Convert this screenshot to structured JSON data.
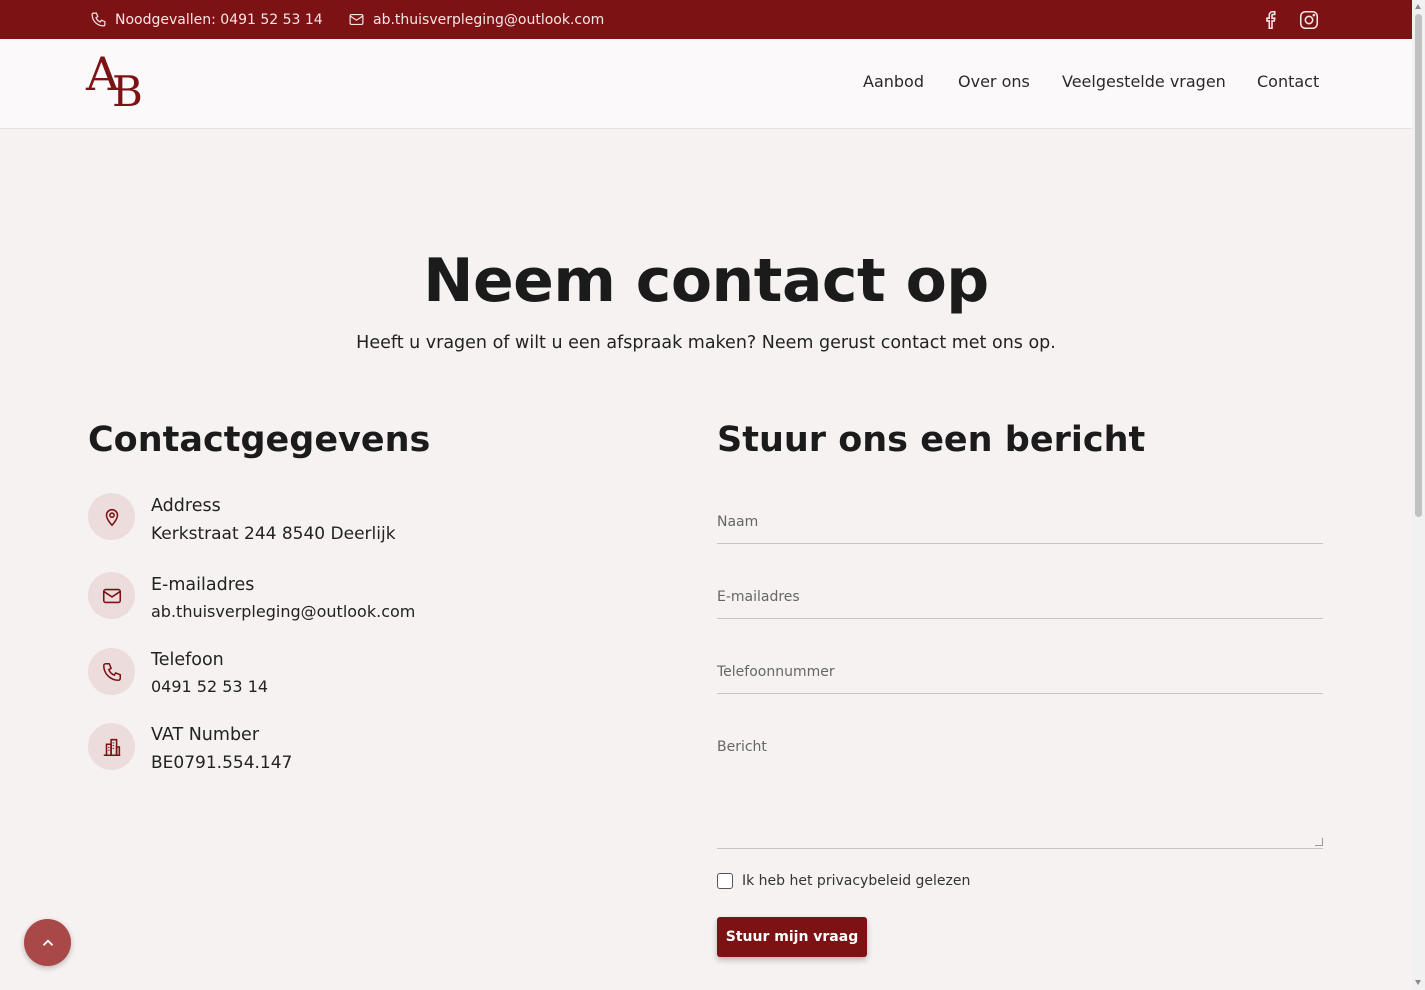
{
  "topbar": {
    "phone_text": "Noodgevallen: 0491 52 53 14",
    "email_text": "ab.thuisverpleging@outlook.com",
    "icons": [
      "phone-icon",
      "mail-icon",
      "facebook-icon",
      "instagram-icon"
    ]
  },
  "header": {
    "logo_a": "A",
    "logo_b": "B",
    "nav": [
      "Aanbod",
      "Over ons",
      "Veelgestelde vragen",
      "Contact"
    ]
  },
  "hero": {
    "title": "Neem contact op",
    "subtitle": "Heeft u vragen of wilt u een afspraak maken? Neem gerust contact met ons op."
  },
  "contact": {
    "title": "Contactgegevens",
    "items": [
      {
        "label": "Address",
        "value": "Kerkstraat 244 8540 Deerlijk",
        "icon": "location-pin-icon"
      },
      {
        "label": "E-mailadres",
        "value": "ab.thuisverpleging@outlook.com",
        "icon": "mail-icon"
      },
      {
        "label": "Telefoon",
        "value": "0491 52 53 14",
        "icon": "phone-icon"
      },
      {
        "label": "VAT Number",
        "value": "BE0791.554.147",
        "icon": "building-icon"
      }
    ]
  },
  "form": {
    "title": "Stuur ons een bericht",
    "fields": {
      "name": "Naam",
      "email": "E-mailadres",
      "phone": "Telefoonnummer",
      "message": "Bericht"
    },
    "privacy_label": "Ik heb het privacybeleid gelezen",
    "submit_label": "Stuur mijn vraag"
  },
  "colors": {
    "brand": "#7d1214",
    "background": "#f6f2f1",
    "scroll_top_button": "#a84848"
  }
}
